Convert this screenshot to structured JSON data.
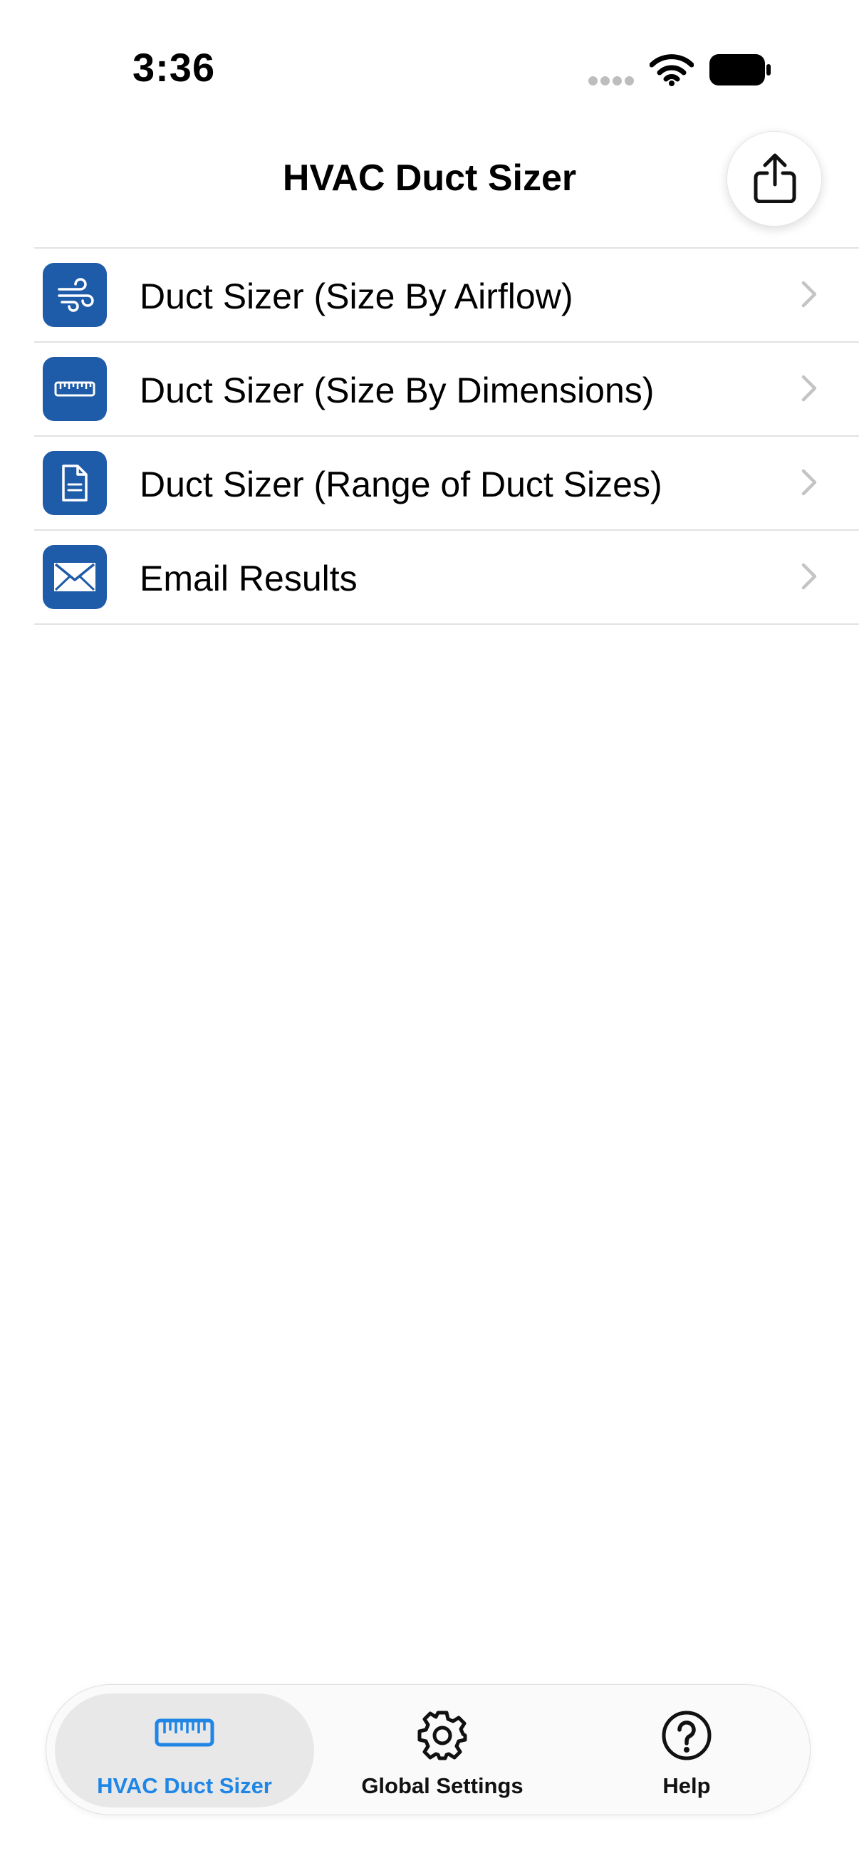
{
  "status_bar": {
    "time": "3:36"
  },
  "header": {
    "title": "HVAC Duct Sizer",
    "share_icon": "share-icon"
  },
  "menu": {
    "items": [
      {
        "label": "Duct Sizer (Size By Airflow)",
        "icon": "wind-icon"
      },
      {
        "label": "Duct Sizer (Size By Dimensions)",
        "icon": "ruler-icon"
      },
      {
        "label": "Duct Sizer (Range of Duct Sizes)",
        "icon": "document-icon"
      },
      {
        "label": "Email Results",
        "icon": "envelope-icon"
      }
    ]
  },
  "tab_bar": {
    "tabs": [
      {
        "label": "HVAC Duct Sizer",
        "icon": "ruler-icon",
        "selected": true
      },
      {
        "label": "Global Settings",
        "icon": "gear-icon",
        "selected": false
      },
      {
        "label": "Help",
        "icon": "question-circle-icon",
        "selected": false
      }
    ]
  },
  "colors": {
    "accent": "#1f86e6",
    "icon_tile": "#1e5ba8",
    "separator": "#e2e2e2"
  }
}
